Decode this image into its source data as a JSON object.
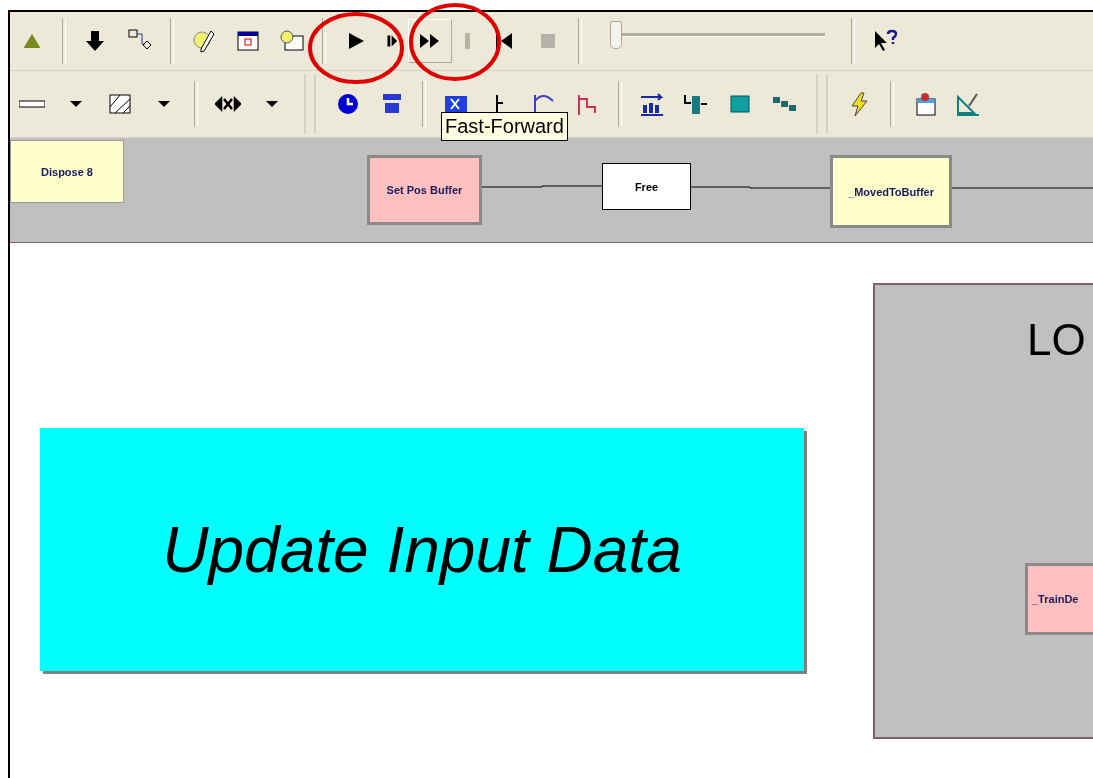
{
  "run_controls": [
    {
      "kind": "play",
      "disabled": false,
      "hovered": false
    },
    {
      "kind": "step",
      "disabled": false,
      "hovered": false
    },
    {
      "kind": "fast_forward",
      "disabled": false,
      "hovered": true
    },
    {
      "kind": "pause",
      "disabled": true,
      "hovered": false
    },
    {
      "kind": "start",
      "disabled": false,
      "hovered": false
    },
    {
      "kind": "stop",
      "disabled": true,
      "hovered": false
    }
  ],
  "speed_slider": {
    "level": 0.02
  },
  "tooltip": "Fast-Forward",
  "flow_strip": {
    "nodes": [
      {
        "kind": "dispose",
        "label": "Dispose 8"
      },
      {
        "kind": "assign",
        "label": "Set Pos Buffer"
      },
      {
        "kind": "free",
        "label": "Free"
      },
      {
        "kind": "signal",
        "label": "_MovedToBuffer"
      }
    ]
  },
  "canvas": {
    "banner": {
      "label": "Update Input Data"
    },
    "panel": {
      "title": "LO",
      "node": {
        "kind": "assign",
        "label": "_TrainDe"
      }
    }
  }
}
